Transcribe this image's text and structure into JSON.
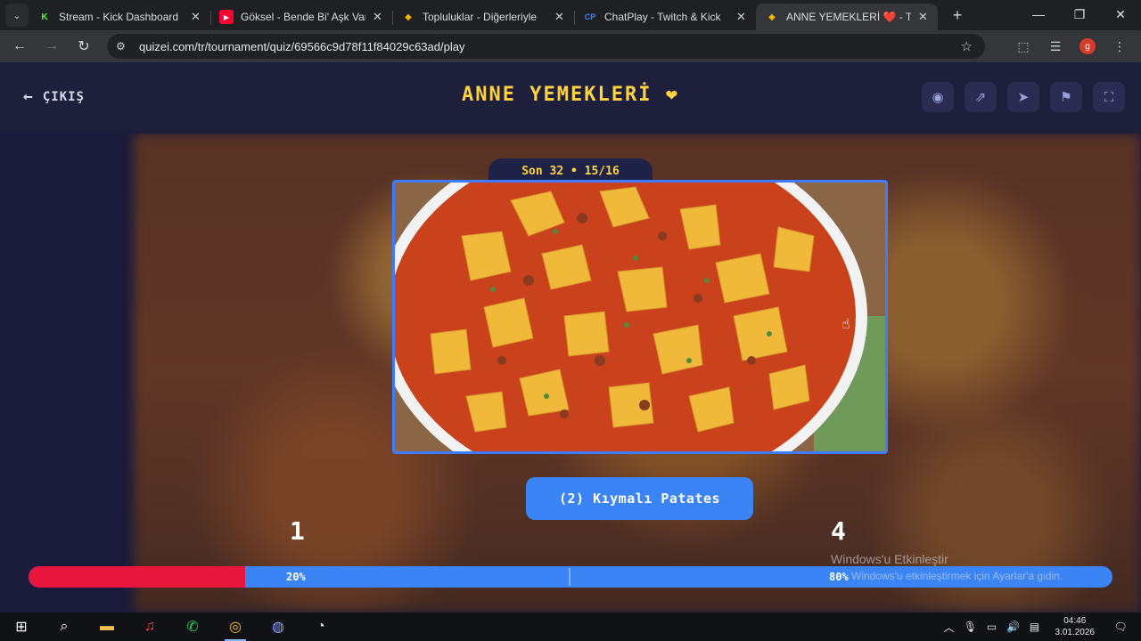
{
  "browser": {
    "tabs": [
      {
        "title": "Stream - Kick Dashboard",
        "favicon": "K",
        "favicon_color": "#53fc18",
        "active": false
      },
      {
        "title": "Göksel - Bende Bi' Aşk Var",
        "favicon": "▶",
        "favicon_color": "#ff0033",
        "active": false
      },
      {
        "title": "Topluluklar - Diğerleriyle",
        "favicon": "◆",
        "favicon_color": "#f4b400",
        "active": false
      },
      {
        "title": "ChatPlay - Twitch & Kick",
        "favicon": "CP",
        "favicon_color": "#3b82f6",
        "active": false
      },
      {
        "title": "ANNE YEMEKLERİ ❤️ - T",
        "favicon": "◆",
        "favicon_color": "#f4b400",
        "active": true
      }
    ],
    "url": "quizei.com/tr/tournament/quiz/69566c9d78f11f84029c63ad/play",
    "profile_initial": "g"
  },
  "app": {
    "exit_label": "ÇIKIŞ",
    "title": "ANNE YEMEKLERİ",
    "title_emoji": "❤",
    "round_label": "Son 32 • 15/16",
    "choice_label": "(2) Kıymalı Patates",
    "left_count": "1",
    "right_count": "4",
    "progress": {
      "left_percent": 20,
      "right_percent": 80,
      "left_label": "20%",
      "right_label": "80%"
    },
    "colors": {
      "accent_yellow": "#ffd23f",
      "blue": "#3a84f5",
      "red": "#e8163c"
    }
  },
  "watermark": {
    "line1": "Windows'u Etkinleştir",
    "line2": "Windows'u etkinleştirmek için Ayarlar'a gidin."
  },
  "taskbar": {
    "time": "04:46",
    "date": "3.01.2026"
  }
}
